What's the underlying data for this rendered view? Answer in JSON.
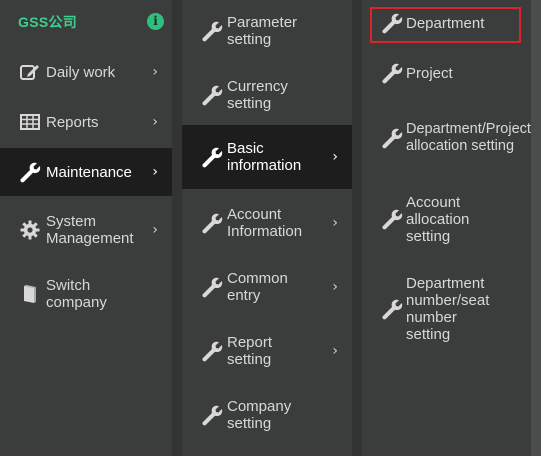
{
  "brand": {
    "title": "GSS公司",
    "info_icon": "i"
  },
  "colors": {
    "accent": "#3fcf8e",
    "panel": "#3a3d3b",
    "active": "#1c1d1c",
    "highlight": "#d9252a"
  },
  "menu1": [
    {
      "label": "Daily work",
      "icon": "edit-icon",
      "chevron": "›"
    },
    {
      "label": "Reports",
      "icon": "table-icon",
      "chevron": "›"
    },
    {
      "label": "Maintenance",
      "icon": "wrench-icon",
      "chevron": "›",
      "active": true
    },
    {
      "label": "System Management",
      "icon": "gear-icon",
      "chevron": "›"
    },
    {
      "label": "Switch company",
      "icon": "book-icon"
    }
  ],
  "menu2": [
    {
      "label": "Parameter setting"
    },
    {
      "label": "Currency setting"
    },
    {
      "label": "Basic information",
      "chevron": "›",
      "active": true
    },
    {
      "label": "Account Information",
      "chevron": "›"
    },
    {
      "label": "Common entry",
      "chevron": "›"
    },
    {
      "label": "Report setting",
      "chevron": "›"
    },
    {
      "label": "Company setting"
    }
  ],
  "menu3": [
    {
      "label": "Department",
      "highlighted": true
    },
    {
      "label": "Project"
    },
    {
      "label": "Department/Project allocation setting"
    },
    {
      "label": "Account allocation setting"
    },
    {
      "label": "Department number/seat number setting"
    }
  ]
}
